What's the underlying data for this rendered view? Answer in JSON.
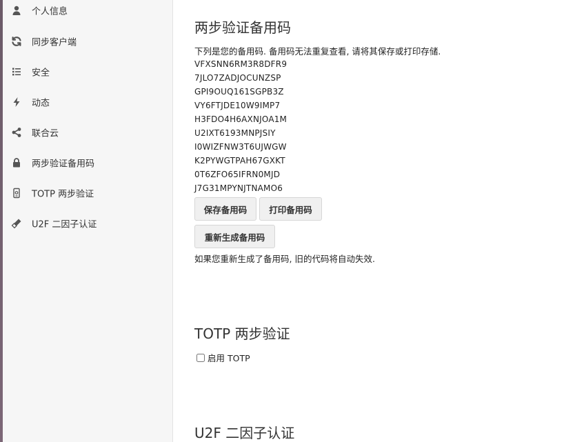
{
  "sidebar": {
    "items": [
      {
        "label": "个人信息",
        "icon": "user-icon"
      },
      {
        "label": "同步客户端",
        "icon": "sync-icon"
      },
      {
        "label": "安全",
        "icon": "list-icon"
      },
      {
        "label": "动态",
        "icon": "bolt-icon"
      },
      {
        "label": "联合云",
        "icon": "share-icon"
      },
      {
        "label": "两步验证备用码",
        "icon": "lock-icon"
      },
      {
        "label": "TOTP 两步验证",
        "icon": "phone-icon"
      },
      {
        "label": "U2F 二因子认证",
        "icon": "usb-key-icon"
      }
    ]
  },
  "backup_codes": {
    "title": "两步验证备用码",
    "description": "下列是您的备用码. 备用码无法重复查看, 请将其保存或打印存储.",
    "codes": [
      "VFXSNN6RM3R8DFR9",
      "7JLO7ZADJOCUNZSP",
      "GPI9OUQ161SGPB3Z",
      "VY6FTJDE10W9IMP7",
      "H3FDO4H6AXNJOA1M",
      "U2IXT6193MNPJSIY",
      "I0WIZFNW3T6UJWGW",
      "K2PYWGTPAH67GXKT",
      "0T6ZFO65IFRN0MJD",
      "J7G31MPYNJTNAMO6"
    ],
    "save_label": "保存备用码",
    "print_label": "打印备用码",
    "regenerate_label": "重新生成备用码",
    "note": "如果您重新生成了备用码, 旧的代码将自动失效."
  },
  "totp": {
    "title": "TOTP 两步验证",
    "enable_label": "启用 TOTP",
    "enabled": false
  },
  "u2f": {
    "title": "U2F 二因子认证"
  },
  "colors": {
    "sidebar_bg": "#f6f6f6",
    "button_bg": "#f0f0f0",
    "text": "#222222"
  }
}
